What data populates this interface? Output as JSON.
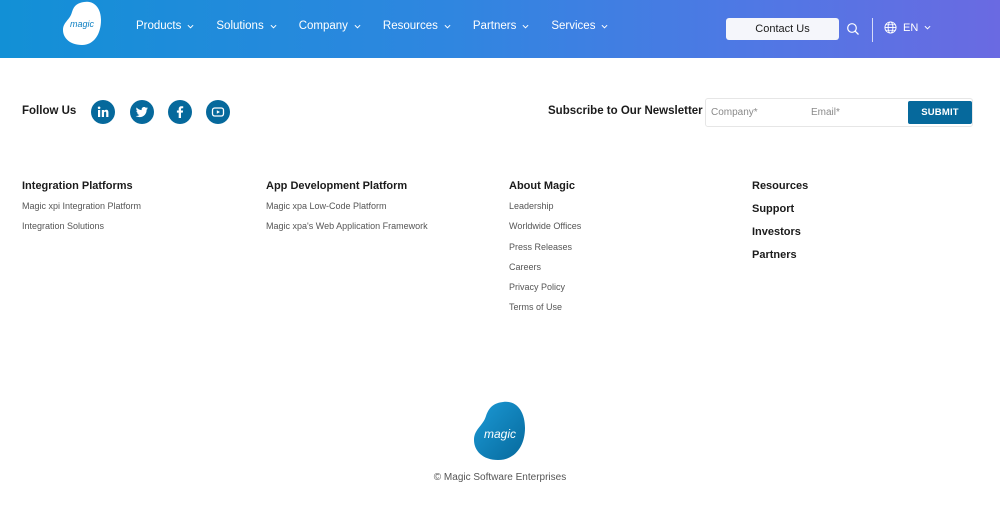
{
  "header": {
    "logo_text": "magic",
    "nav": [
      {
        "label": "Products"
      },
      {
        "label": "Solutions"
      },
      {
        "label": "Company"
      },
      {
        "label": "Resources"
      },
      {
        "label": "Partners"
      },
      {
        "label": "Services"
      }
    ],
    "contact_label": "Contact Us",
    "language": "EN"
  },
  "social": {
    "label": "Follow Us",
    "icons": [
      "linkedin-icon",
      "twitter-icon",
      "facebook-icon",
      "youtube-icon"
    ]
  },
  "newsletter": {
    "label": "Subscribe to Our Newsletter",
    "company_placeholder": "Company*",
    "email_placeholder": "Email*",
    "submit_label": "SUBMIT"
  },
  "footer": {
    "integration": {
      "title": "Integration Platforms",
      "links": [
        "Magic xpi Integration Platform",
        "Integration Solutions"
      ]
    },
    "appdev": {
      "title": "App Development Platform",
      "links": [
        "Magic xpa Low-Code Platform",
        "Magic xpa's Web Application Framework"
      ]
    },
    "about": {
      "title": "About Magic",
      "links": [
        "Leadership",
        "Worldwide Offices",
        "Press Releases",
        "Careers",
        "Privacy Policy",
        "Terms of Use"
      ]
    },
    "other": [
      "Resources",
      "Support",
      "Investors",
      "Partners"
    ]
  },
  "bottom": {
    "logo_text": "magic",
    "copyright": "© Magic Software Enterprises"
  },
  "colors": {
    "brand": "#06699c",
    "header_start": "#1290d6",
    "header_end": "#6a6ae2"
  }
}
